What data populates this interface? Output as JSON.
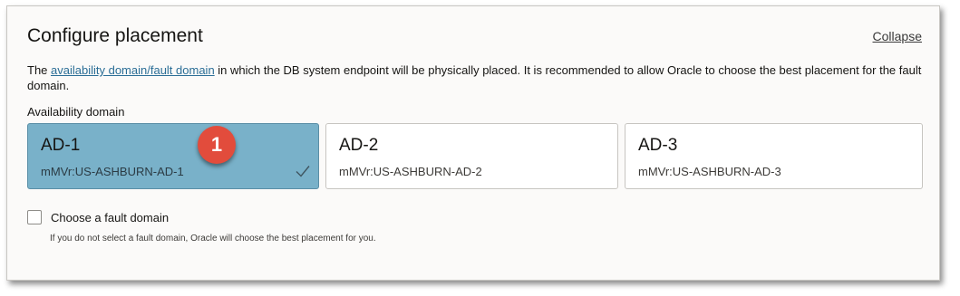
{
  "panel": {
    "title": "Configure placement",
    "collapse_label": "Collapse",
    "description_prefix": "The ",
    "description_link": "availability domain/fault domain",
    "description_suffix": " in which the DB system endpoint will be physically placed. It is recommended to allow Oracle to choose the best placement for the fault domain."
  },
  "availability_domain": {
    "label": "Availability domain",
    "options": [
      {
        "name": "AD-1",
        "sub": "mMVr:US-ASHBURN-AD-1",
        "selected": true
      },
      {
        "name": "AD-2",
        "sub": "mMVr:US-ASHBURN-AD-2",
        "selected": false
      },
      {
        "name": "AD-3",
        "sub": "mMVr:US-ASHBURN-AD-3",
        "selected": false
      }
    ]
  },
  "fault_domain": {
    "checkbox_label": "Choose a fault domain",
    "checked": false,
    "helper": "If you do not select a fault domain, Oracle will choose the best placement for you."
  },
  "annotation": {
    "badge_number": "1",
    "color": "#e24c3c"
  },
  "colors": {
    "selected_card": "#79b1c9",
    "link": "#2a6d96"
  }
}
